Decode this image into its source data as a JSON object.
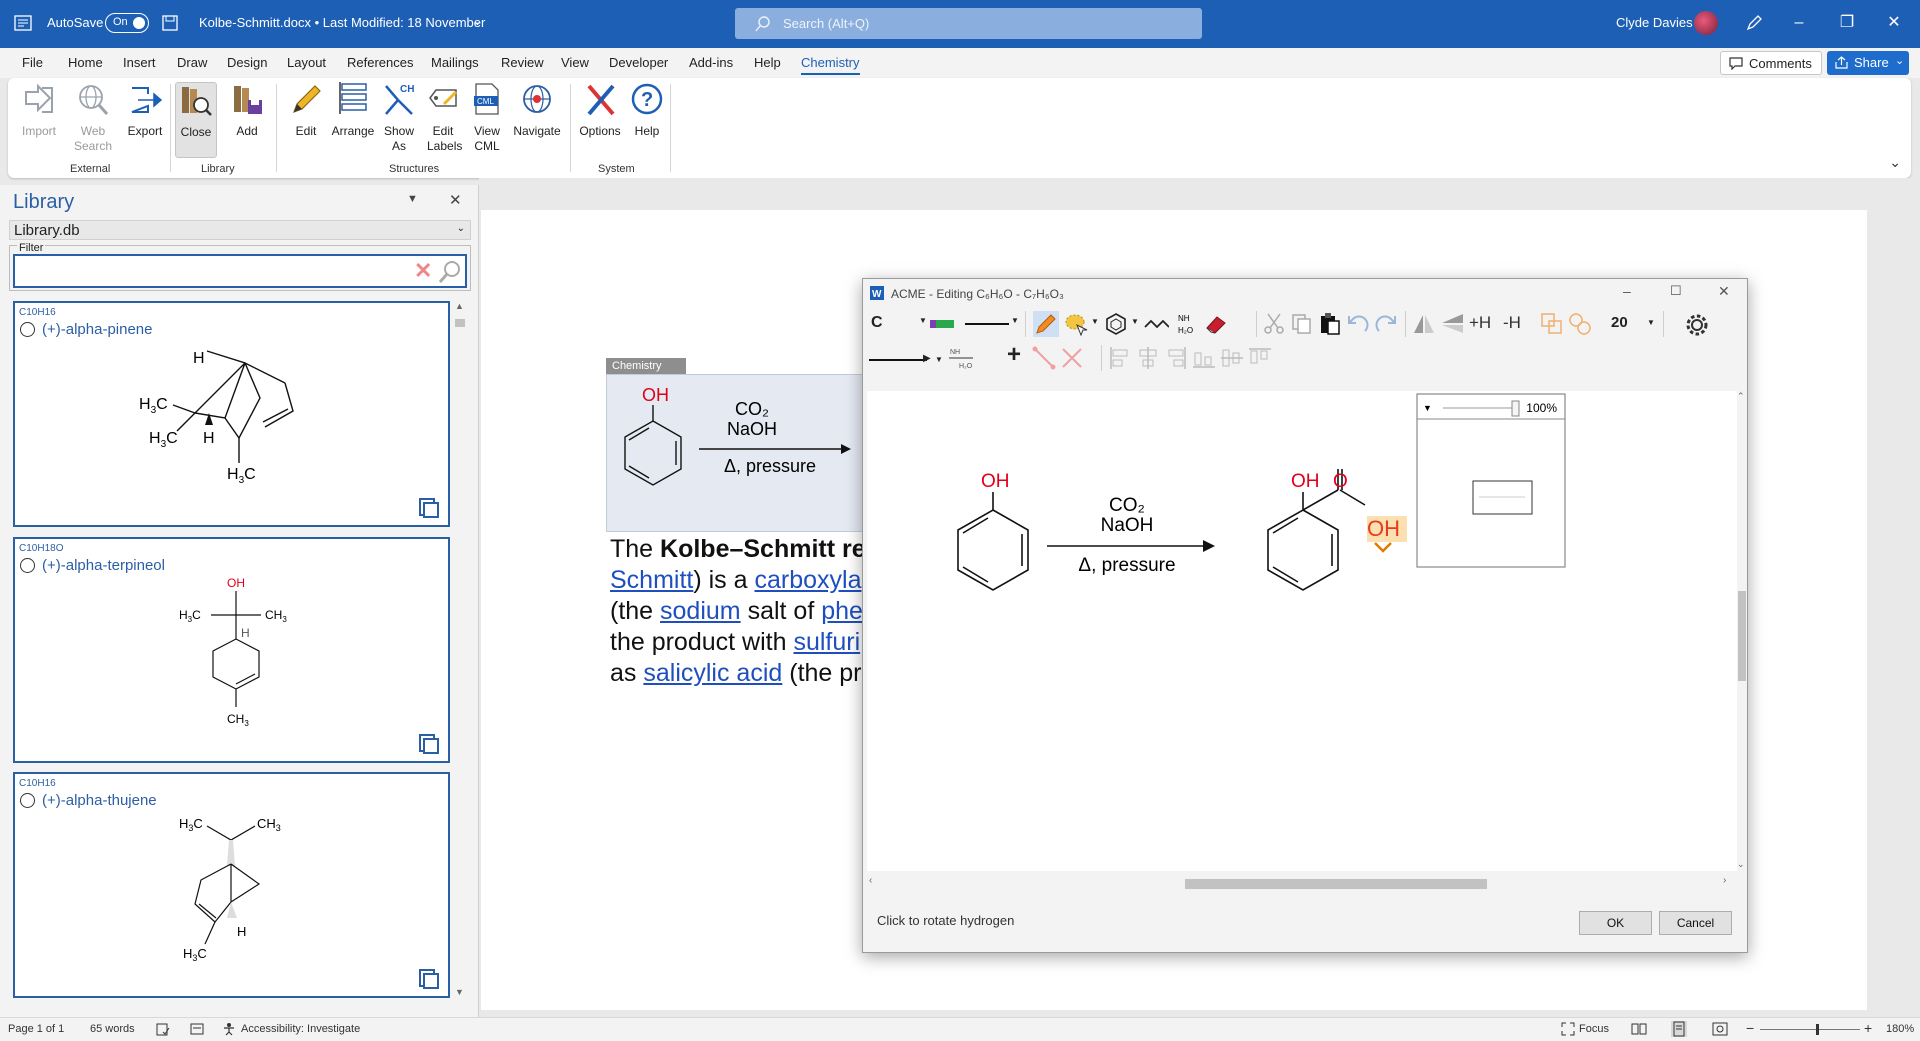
{
  "titlebar": {
    "autosave_label": "AutoSave",
    "autosave_state": "On",
    "doc_title": "Kolbe-Schmitt.docx • Last Modified: 18 November",
    "search_placeholder": "Search (Alt+Q)",
    "user_name": "Clyde Davies"
  },
  "menu": {
    "items": [
      "File",
      "Home",
      "Insert",
      "Draw",
      "Design",
      "Layout",
      "References",
      "Mailings",
      "Review",
      "View",
      "Developer",
      "Add-ins",
      "Help",
      "Chemistry"
    ],
    "active": "Chemistry",
    "comments": "Comments",
    "share": "Share"
  },
  "ribbon": {
    "import": "Import",
    "web_search": "Web Search",
    "export": "Export",
    "close": "Close",
    "add": "Add",
    "edit": "Edit",
    "arrange": "Arrange",
    "show_as": "Show As",
    "edit_labels": "Edit Labels",
    "view_cml": "View CML",
    "navigate": "Navigate",
    "options": "Options",
    "help": "Help",
    "groups": {
      "external": "External",
      "library": "Library",
      "structures": "Structures",
      "system": "System"
    }
  },
  "library": {
    "title": "Library",
    "db": "Library.db",
    "filter_label": "Filter",
    "filter_value": "",
    "entries": [
      {
        "formula": "C10H16",
        "name": "(+)-alpha-pinene"
      },
      {
        "formula": "C10H18O",
        "name": "(+)-alpha-terpineol"
      },
      {
        "formula": "C10H16",
        "name": "(+)-alpha-thujene"
      }
    ]
  },
  "document": {
    "chem_tag": "Chemistry",
    "reaction": {
      "reagent1": "CO₂",
      "reagent2": "NaOH",
      "condition": "Δ, pressure",
      "oh": "OH"
    },
    "lines": [
      [
        "The ",
        "Kolbe–Schmitt re"
      ],
      [
        "Schmitt",
        ") is a ",
        "carboxyla"
      ],
      [
        "(the ",
        "sodium",
        " salt of ",
        "phe"
      ],
      [
        "the product with ",
        "sulfuri"
      ],
      [
        "as ",
        "salicylic acid",
        " (the pr"
      ]
    ]
  },
  "dialog": {
    "title": "ACME - Editing C₆H₆O - C₇H₆O₃",
    "element": "C",
    "font_size": "20",
    "add_h": "+H",
    "remove_h": "-H",
    "zoom": "100%",
    "reaction": {
      "reagent1": "CO₂",
      "reagent2": "NaOH",
      "condition": "Δ, pressure",
      "oh1": "OH",
      "oh2": "OH",
      "o": "O",
      "oh3": "OH"
    },
    "status": "Click to rotate hydrogen",
    "ok": "OK",
    "cancel": "Cancel"
  },
  "statusbar": {
    "page": "Page 1 of 1",
    "words": "65 words",
    "accessibility": "Accessibility: Investigate",
    "focus": "Focus",
    "zoom": "180%"
  },
  "colors": {
    "word_blue": "#1e5fb6",
    "link_blue": "#1f4fbf",
    "oh_red": "#e0001a",
    "library_blue": "#2b5fa5"
  }
}
